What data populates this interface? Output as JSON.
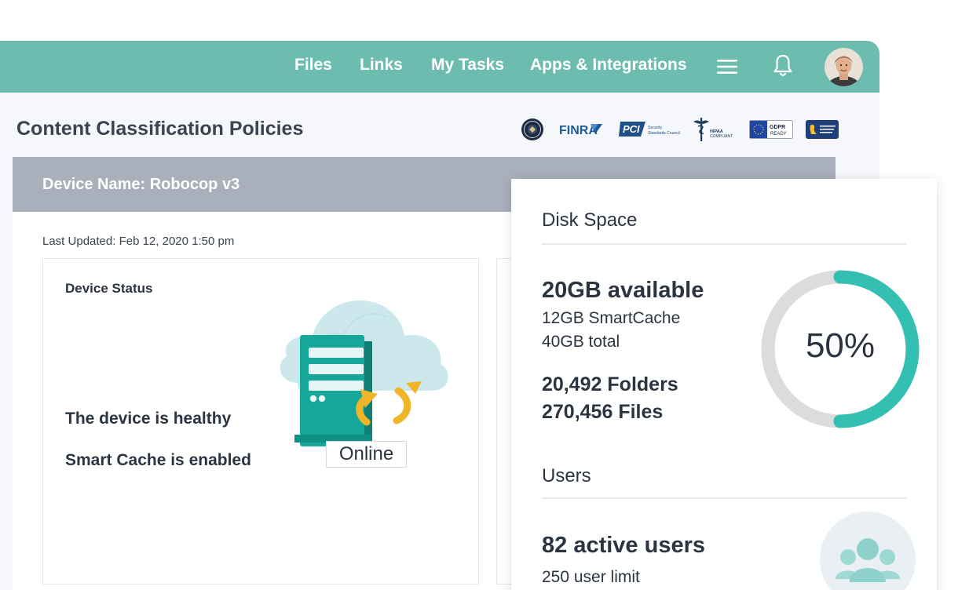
{
  "nav": {
    "items": [
      "Files",
      "Links",
      "My Tasks",
      "Apps & Integrations"
    ]
  },
  "page": {
    "title": "Content Classification Policies"
  },
  "compliance_logos": [
    {
      "name": "seal",
      "text": ""
    },
    {
      "name": "finra",
      "text": "FINRA"
    },
    {
      "name": "pci",
      "text": "PCI Security Standards Council"
    },
    {
      "name": "hipaa",
      "text": "HIPAA COMPLIANT"
    },
    {
      "name": "gdpr",
      "text": "GDPR READY"
    },
    {
      "name": "ccpa",
      "text": "CALIFORNIA CONSUMER PRIVACY ACT"
    }
  ],
  "device": {
    "name_label": "Device Name: Robocop v3",
    "last_updated": "Last Updated: Feb 12, 2020 1:50 pm",
    "status_title": "Device Status",
    "health_text": "The device is healthy",
    "cache_text": "Smart Cache is enabled",
    "online_label": "Online"
  },
  "disk": {
    "title": "Disk Space",
    "available": "20GB available",
    "smartcache": "12GB SmartCache",
    "total": "40GB total",
    "folders": "20,492 Folders",
    "files": "270,456 Files",
    "percent_label": "50%",
    "percent_value": 0.5
  },
  "users": {
    "title": "Users",
    "active": "82 active users",
    "limit": "250 user limit"
  },
  "colors": {
    "teal_header": "#6dbcb0",
    "teal_accent": "#34bfb3",
    "device_bar": "#a9afbb",
    "donut_track": "#dcdcdc",
    "gold_arrows": "#f0b429"
  }
}
